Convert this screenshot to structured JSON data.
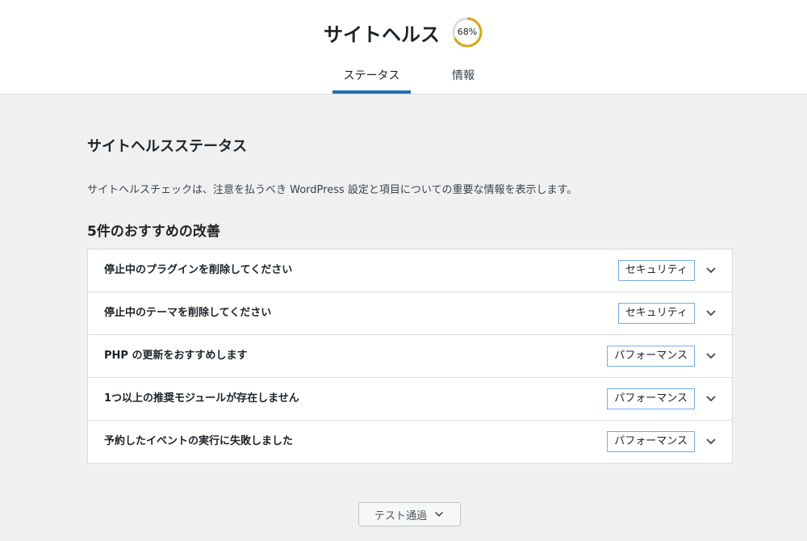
{
  "header": {
    "title": "サイトヘルス",
    "score": "68%",
    "score_fraction": 0.68,
    "ring_color": "#dba617"
  },
  "tabs": [
    {
      "label": "ステータス",
      "active": true
    },
    {
      "label": "情報",
      "active": false
    }
  ],
  "main": {
    "section_title": "サイトヘルスステータス",
    "description": "サイトヘルスチェックは、注意を払うべき WordPress 設定と項目についての重要な情報を表示します。",
    "recommended_count_title": "5件のおすすめの改善",
    "issues": [
      {
        "label": "停止中のプラグインを削除してください",
        "badge": "セキュリティ"
      },
      {
        "label": "停止中のテーマを削除してください",
        "badge": "セキュリティ"
      },
      {
        "label": "PHP の更新をおすすめします",
        "badge": "パフォーマンス"
      },
      {
        "label": "1つ以上の推奨モジュールが存在しません",
        "badge": "パフォーマンス"
      },
      {
        "label": "予約したイベントの実行に失敗しました",
        "badge": "パフォーマンス"
      }
    ],
    "passed_button_label": "テスト通過"
  },
  "colors": {
    "accent": "#2271b1",
    "badge_border": "#72aee6"
  },
  "icons": {
    "issue_toggle": "chevron-down-icon",
    "passed_toggle": "chevron-down-icon"
  }
}
